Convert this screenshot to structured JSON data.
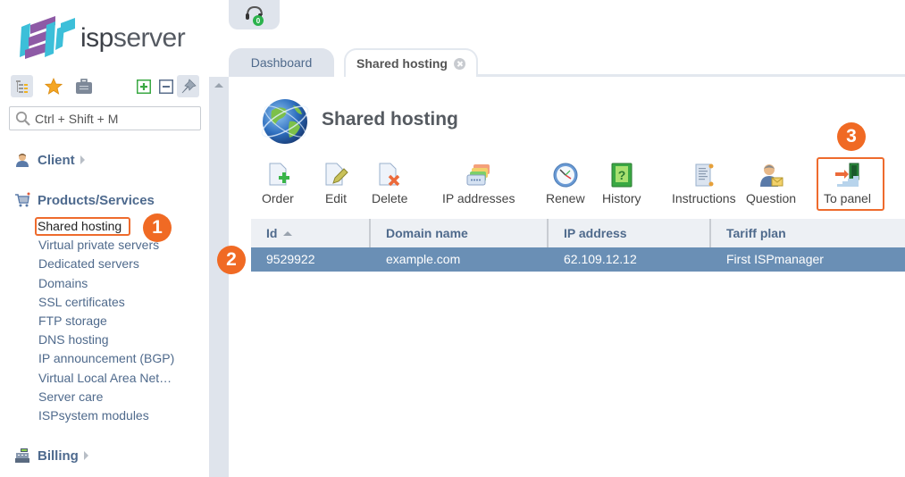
{
  "app": {
    "logo_text_bold": "isp",
    "logo_text": "server"
  },
  "sidebar": {
    "search_placeholder": "Ctrl + Shift + M",
    "tools": [
      {
        "name": "tree-view-icon",
        "active": true
      },
      {
        "name": "favorites-star-icon",
        "active": false
      },
      {
        "name": "briefcase-icon",
        "active": false
      },
      {
        "name": "expand-all-icon",
        "active": false
      },
      {
        "name": "collapse-all-icon",
        "active": false
      },
      {
        "name": "pin-icon",
        "active": true
      }
    ],
    "sections": {
      "client": "Client",
      "products": "Products/Services",
      "billing": "Billing"
    },
    "products_items": [
      "Shared hosting",
      "Virtual private servers",
      "Dedicated servers",
      "Domains",
      "SSL certificates",
      "FTP storage",
      "DNS hosting",
      "IP announcement (BGP)",
      "Virtual Local Area Net…",
      "Server care",
      "ISPsystem modules"
    ],
    "selected_item": "Shared hosting"
  },
  "header": {
    "support_badge_count": "0",
    "tabs": [
      {
        "label": "Dashboard",
        "active": false
      },
      {
        "label": "Shared hosting",
        "active": true
      }
    ]
  },
  "main": {
    "title": "Shared hosting",
    "toolbar": [
      {
        "label": "Order",
        "icon": "order-add-icon"
      },
      {
        "label": "Edit",
        "icon": "edit-pencil-icon"
      },
      {
        "label": "Delete",
        "icon": "delete-x-icon"
      },
      {
        "label": "IP addresses",
        "icon": "ip-addresses-icon"
      },
      {
        "label": "Renew",
        "icon": "renew-clock-icon"
      },
      {
        "label": "History",
        "icon": "history-book-icon"
      },
      {
        "label": "Instructions",
        "icon": "instructions-scroll-icon"
      },
      {
        "label": "Question",
        "icon": "question-user-icon"
      },
      {
        "label": "To panel",
        "icon": "to-panel-stairs-icon"
      }
    ],
    "table": {
      "columns": [
        "Id",
        "Domain name",
        "IP address",
        "Tariff plan"
      ],
      "sorted_column": "Id",
      "rows": [
        {
          "id": "9529922",
          "domain": "example.com",
          "ip": "62.109.12.12",
          "tariff": "First ISPmanager"
        }
      ]
    }
  },
  "annotations": {
    "badge1": "1",
    "badge2": "2",
    "badge3": "3",
    "accent_color": "#f06a24"
  },
  "colors": {
    "selected_row": "#6a8fb5",
    "link": "#4f6a8c",
    "panel_bg": "#dfe4ec"
  }
}
